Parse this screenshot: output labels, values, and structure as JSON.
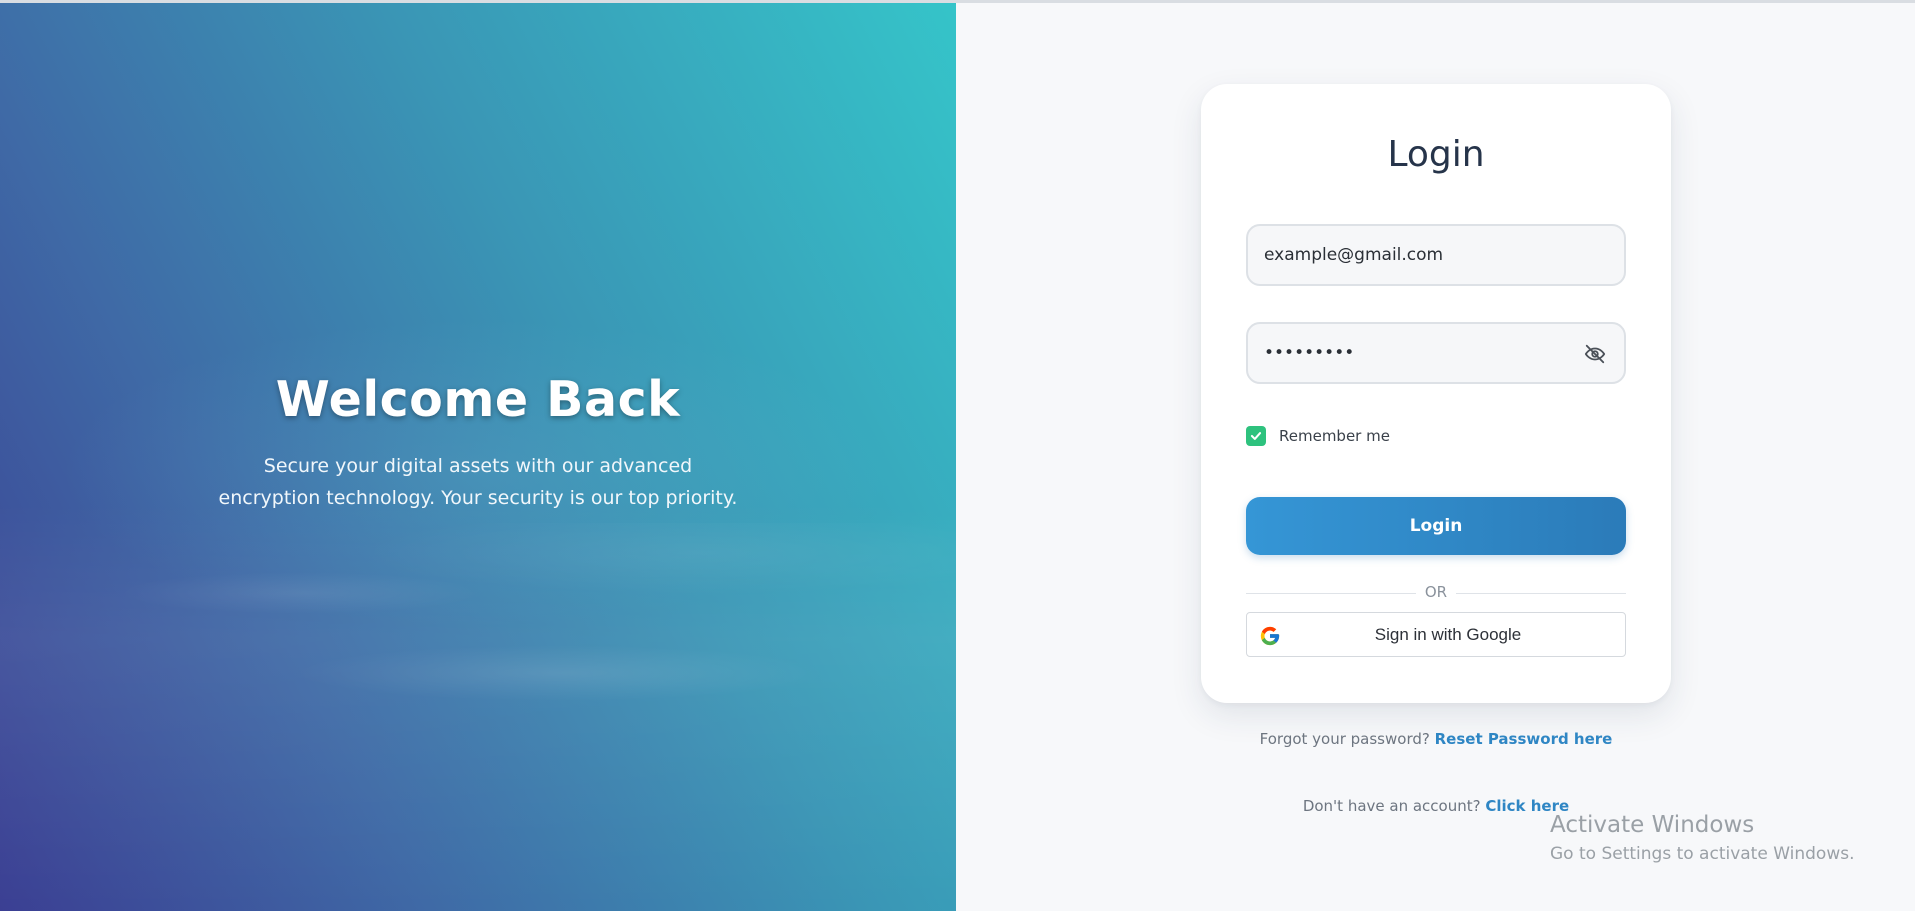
{
  "hero": {
    "title": "Welcome Back",
    "subtitle": "Secure your digital assets with our advanced encryption technology. Your security is our top priority."
  },
  "login_card": {
    "title": "Login",
    "email_value": "example@gmail.com",
    "password_value": "•••••••••",
    "password_toggle_icon": "eye-off-icon",
    "remember_label": "Remember me",
    "remember_checked": true,
    "login_button": "Login",
    "divider": "OR",
    "google_button": "Sign in with Google",
    "google_icon": "google-icon"
  },
  "links": {
    "forgot_text": "Forgot your password?",
    "forgot_link": "Reset Password here",
    "signup_text": "Don't have an account?",
    "signup_link": "Click here"
  },
  "watermark": {
    "title": "Activate Windows",
    "subtitle": "Go to Settings to activate Windows."
  },
  "colors": {
    "accent": "#2f86c4",
    "checkbox": "#2ec27e",
    "heading": "#26344a"
  }
}
